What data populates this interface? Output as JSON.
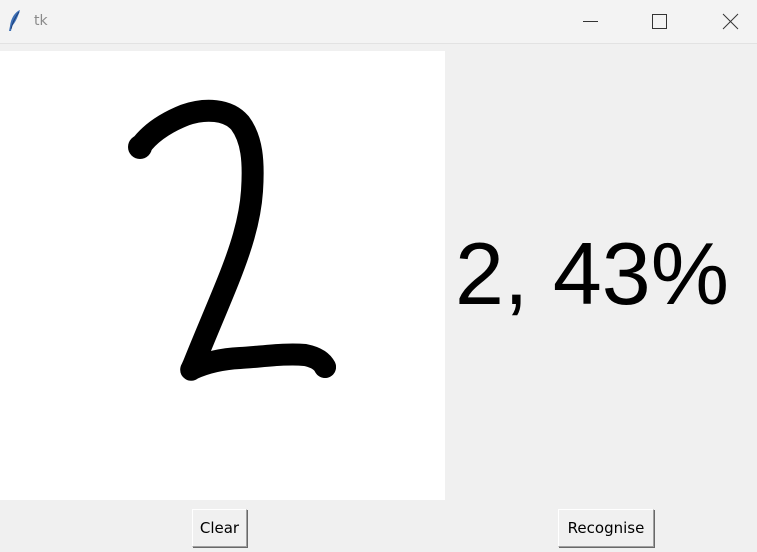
{
  "window": {
    "title": "tk",
    "app_icon": "tk-feather-icon",
    "controls": {
      "minimize_icon": "minimize-icon",
      "maximize_icon": "maximize-icon",
      "close_icon": "close-icon"
    }
  },
  "canvas": {
    "background": "#ffffff",
    "stroke_color": "#000000"
  },
  "result": {
    "text": "2, 43%"
  },
  "buttons": {
    "clear_label": "Clear",
    "recognise_label": "Recognise"
  }
}
